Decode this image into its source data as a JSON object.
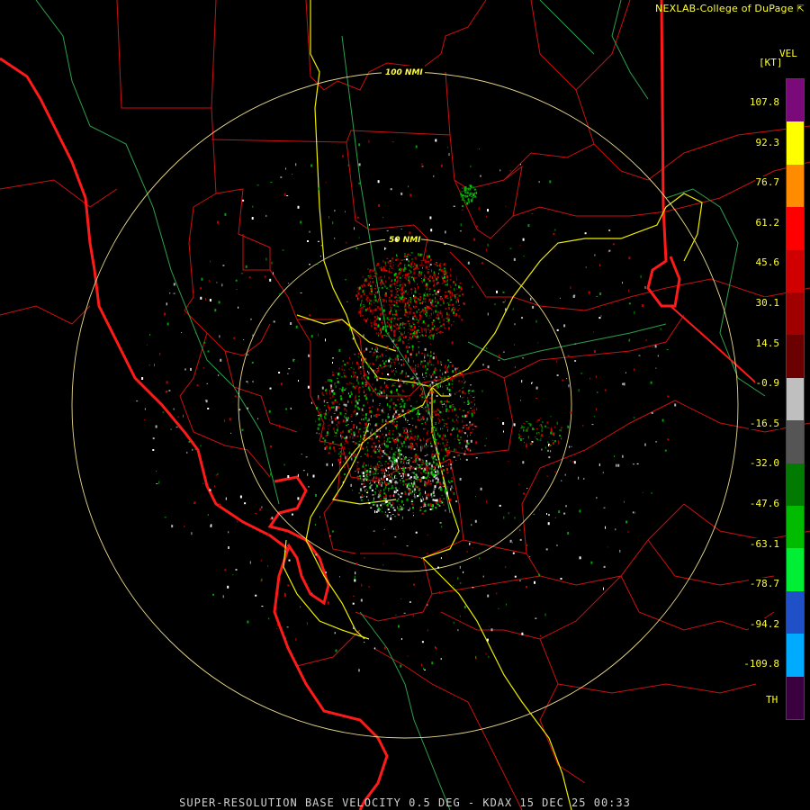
{
  "header": {
    "credit": "NEXLAB-College of DuPage"
  },
  "legend": {
    "title": "VEL",
    "unit": "[KT]",
    "ticks": [
      "107.8",
      "92.3",
      "76.7",
      "61.2",
      "45.6",
      "30.1",
      "14.5",
      "-0.9",
      "-16.5",
      "-32.0",
      "-47.6",
      "-63.1",
      "-78.7",
      "-94.2",
      "-109.8"
    ],
    "bottom_label": "TH",
    "colors": [
      "#7a0a7a",
      "#ffff00",
      "#ff8c00",
      "#ff0000",
      "#d00000",
      "#a00000",
      "#6b0000",
      "#bfbfbf",
      "#555555",
      "#007a00",
      "#00bb00",
      "#00ee33",
      "#2050c8",
      "#00aaff",
      "#3a0040"
    ]
  },
  "map": {
    "rings": [
      {
        "label": "100 NMI"
      },
      {
        "label": "50 NMI"
      }
    ],
    "colors": {
      "state_border": "#ff2020",
      "county_border": "#dd1010",
      "highway": "#eeee00",
      "river": "#2ea04a",
      "range_ring": "#e8d88a",
      "coastline": "#ff1010"
    }
  },
  "footer": {
    "text": "SUPER-RESOLUTION BASE VELOCITY 0.5 DEG - KDAX 15 DEC 25 00:33"
  }
}
